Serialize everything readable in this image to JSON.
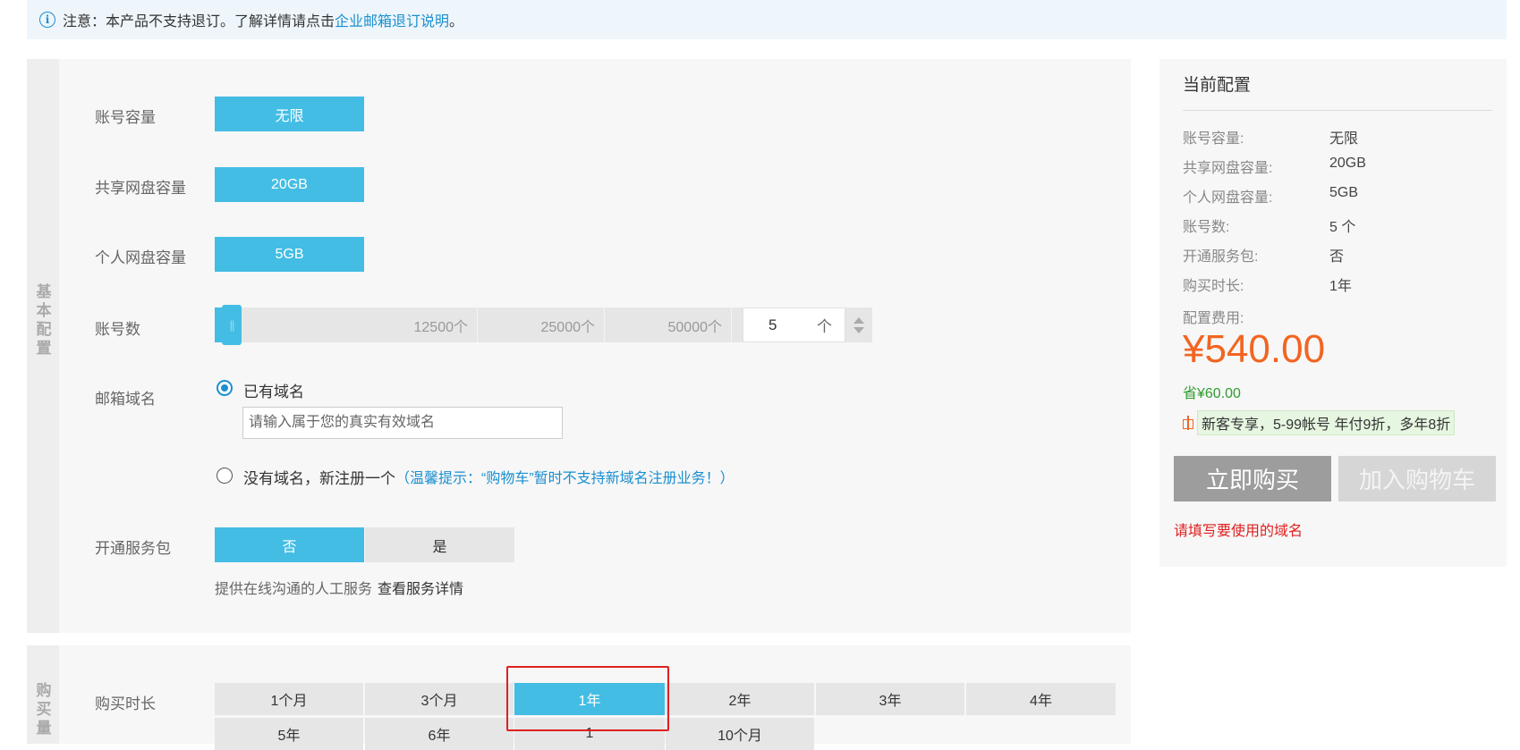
{
  "notice": {
    "prefix": "注意：本产品不支持退订。了解详情请点击",
    "link": "企业邮箱退订说明",
    "suffix": "。"
  },
  "basic": {
    "section_title_chars": [
      "基",
      "本",
      "配",
      "置"
    ],
    "account_capacity": {
      "label": "账号容量",
      "value": "无限"
    },
    "shared_disk": {
      "label": "共享网盘容量",
      "value": "20GB"
    },
    "personal_disk": {
      "label": "个人网盘容量",
      "value": "5GB"
    },
    "accounts": {
      "label": "账号数",
      "ticks": [
        "12500个",
        "25000个",
        "50000个"
      ],
      "value": "5",
      "unit": "个",
      "slider_level": 0
    },
    "domain": {
      "label": "邮箱域名",
      "option_have": "已有域名",
      "input_placeholder": "请输入属于您的真实有效域名",
      "input_value": "",
      "option_new": "没有域名，新注册一个",
      "option_new_hint": "（温馨提示：“购物车”暂时不支持新域名注册业务！）",
      "selected": "have"
    },
    "service_pack": {
      "label": "开通服务包",
      "options": [
        "否",
        "是"
      ],
      "selected": "否",
      "desc": "提供在线沟通的人工服务",
      "desc_link": "查看服务详情"
    }
  },
  "purchase": {
    "section_title_chars": [
      "购",
      "买",
      "量"
    ],
    "duration_label": "购买时长",
    "options_row1": [
      "1个月",
      "3个月",
      "1年",
      "2年",
      "3年",
      "4年"
    ],
    "options_row2": [
      "5年",
      "6年",
      "1",
      "10个月"
    ],
    "selected": "1年"
  },
  "summary": {
    "title": "当前配置",
    "items": [
      {
        "key": "账号容量:",
        "value": "无限"
      },
      {
        "key": "共享网盘容量:",
        "value": "20GB"
      },
      {
        "key": "个人网盘容量:",
        "value": "5GB"
      },
      {
        "key": "账号数:",
        "value": "5 个"
      },
      {
        "key": "开通服务包:",
        "value": "否"
      },
      {
        "key": "购买时长:",
        "value": "1年"
      }
    ],
    "fee_label": "配置费用:",
    "price": "¥540.00",
    "save": "省¥60.00",
    "promo": "新客专享，5-99帐号 年付9折，多年8折",
    "buy_button": "立即购买",
    "cart_button": "加入购物车",
    "warning": "请填写要使用的域名"
  },
  "colors": {
    "accent": "#43bde4",
    "link": "#1a8fd0",
    "price": "#f26522",
    "save": "#2e9d2e",
    "warning": "#e02020"
  }
}
